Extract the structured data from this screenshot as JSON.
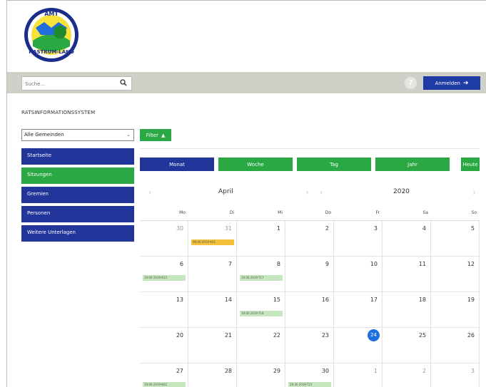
{
  "logo": {
    "text_top": "AMT",
    "text_bottom": "HASTRUM-LAND"
  },
  "header": {
    "search_placeholder": "Suche...",
    "login_label": "Anmelden"
  },
  "sidebar": {
    "section_title": "RATSINFORMATIONSSYSTEM",
    "select_value": "Alle Gemeinden",
    "items": [
      {
        "label": "Startseite",
        "active": false
      },
      {
        "label": "Sitzungen",
        "active": true
      },
      {
        "label": "Gremien",
        "active": false
      },
      {
        "label": "Personen",
        "active": false
      },
      {
        "label": "Weitere Unterlagen",
        "active": false
      }
    ]
  },
  "calendar": {
    "filter_label": "Filter",
    "views": [
      {
        "label": "Monat",
        "active": true
      },
      {
        "label": "Woche",
        "active": false
      },
      {
        "label": "Tag",
        "active": false
      },
      {
        "label": "Jahr",
        "active": false
      },
      {
        "label": "Heute",
        "active": false
      }
    ],
    "month": "April",
    "year": "2020",
    "weekdays": [
      "Mo",
      "Di",
      "Mi",
      "Do",
      "Fr",
      "Sa",
      "So"
    ],
    "today": "24",
    "weeks": [
      [
        {
          "d": "30",
          "other": true
        },
        {
          "d": "31",
          "other": true,
          "event": "09:00 2019-K01",
          "event_color": "yellow"
        },
        {
          "d": "1"
        },
        {
          "d": "2"
        },
        {
          "d": "3"
        },
        {
          "d": "4"
        },
        {
          "d": "5"
        }
      ],
      [
        {
          "d": "6",
          "event": "19:00 2019-K15"
        },
        {
          "d": "7"
        },
        {
          "d": "8",
          "event": "19:30 2019-T17"
        },
        {
          "d": "9"
        },
        {
          "d": "10"
        },
        {
          "d": "11"
        },
        {
          "d": "12"
        }
      ],
      [
        {
          "d": "13"
        },
        {
          "d": "14"
        },
        {
          "d": "15",
          "event": "19:00 2019-T18"
        },
        {
          "d": "16"
        },
        {
          "d": "17"
        },
        {
          "d": "18"
        },
        {
          "d": "19"
        }
      ],
      [
        {
          "d": "20"
        },
        {
          "d": "21"
        },
        {
          "d": "22"
        },
        {
          "d": "23"
        },
        {
          "d": "24",
          "today": true
        },
        {
          "d": "25"
        },
        {
          "d": "26"
        }
      ],
      [
        {
          "d": "27",
          "event": "19:00 2019-K02"
        },
        {
          "d": "28"
        },
        {
          "d": "29"
        },
        {
          "d": "30",
          "event": "19:30 2019-T21"
        },
        {
          "d": "1",
          "other": true
        },
        {
          "d": "2",
          "other": true
        },
        {
          "d": "3",
          "other": true
        }
      ]
    ]
  },
  "colors": {
    "blue": "#22359a",
    "green": "#2aa844",
    "event_green": "#c6e6bd",
    "event_yellow": "#f3c13a",
    "today": "#1f6ee0",
    "topbar": "#cfd1c9"
  }
}
